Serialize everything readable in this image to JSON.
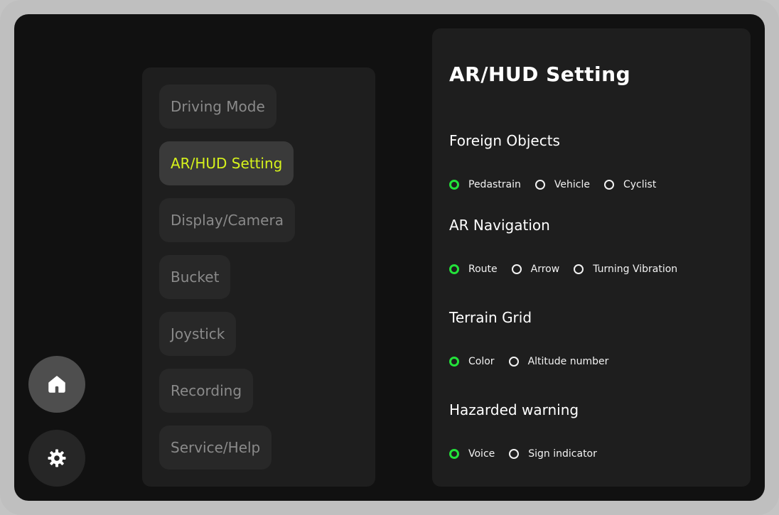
{
  "nav": {
    "home_icon": "home-icon",
    "settings_icon": "gear-icon"
  },
  "menu": {
    "items": [
      {
        "label": "Driving Mode",
        "active": false
      },
      {
        "label": "AR/HUD Setting",
        "active": true
      },
      {
        "label": "Display/Camera",
        "active": false
      },
      {
        "label": "Bucket",
        "active": false
      },
      {
        "label": "Joystick",
        "active": false
      },
      {
        "label": "Recording",
        "active": false
      },
      {
        "label": "Service/Help",
        "active": false
      }
    ]
  },
  "content": {
    "title": "AR/HUD Setting",
    "sections": [
      {
        "title": "Foreign Objects",
        "options": [
          {
            "label": "Pedastrain",
            "checked": true
          },
          {
            "label": "Vehicle",
            "checked": false
          },
          {
            "label": "Cyclist",
            "checked": false
          }
        ]
      },
      {
        "title": "AR Navigation",
        "options": [
          {
            "label": "Route",
            "checked": true
          },
          {
            "label": "Arrow",
            "checked": false
          },
          {
            "label": "Turning Vibration",
            "checked": false
          }
        ]
      },
      {
        "title": "Terrain Grid",
        "options": [
          {
            "label": "Color",
            "checked": true
          },
          {
            "label": "Altitude number",
            "checked": false
          }
        ]
      },
      {
        "title": "Hazarded warning",
        "options": [
          {
            "label": "Voice",
            "checked": true
          },
          {
            "label": "Sign indicator",
            "checked": false
          }
        ]
      }
    ]
  },
  "colors": {
    "accent": "#d6f21c",
    "radio_checked": "#23e23a",
    "panel": "#1e1e1e",
    "background": "#111111"
  }
}
